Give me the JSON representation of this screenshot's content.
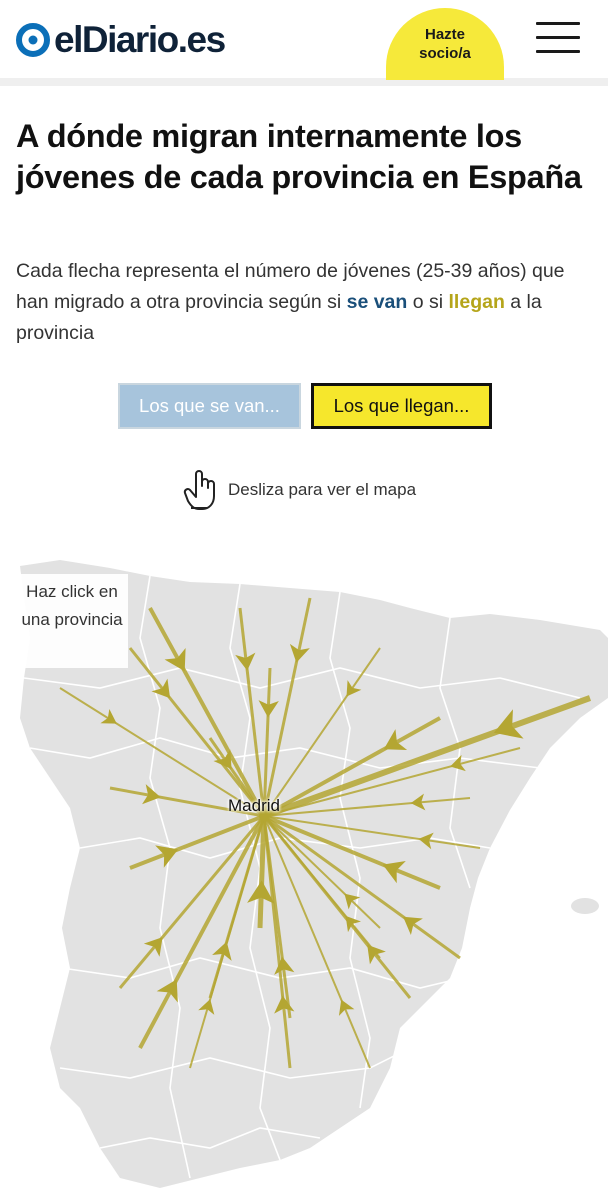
{
  "header": {
    "logo_text": "elDiario.es",
    "subscribe_line1": "Hazte",
    "subscribe_line2": "socio/a",
    "menu_icon": "hamburger-menu-icon"
  },
  "article": {
    "title": "A dónde migran internamente los jóvenes de cada provincia en España",
    "subtitle_part1": "Cada flecha representa el número de jóvenes (25-39 años) que han migrado a otra provincia según si ",
    "subtitle_hl1": "se van",
    "subtitle_part2": " o si ",
    "subtitle_hl2": "llegan",
    "subtitle_part3": " a la provincia"
  },
  "toggle": {
    "van_label": "Los que se van...",
    "llegan_label": "Los que llegan...",
    "selected": "llegan"
  },
  "swipe": {
    "text": "Desliza para ver el mapa",
    "icon": "hand-pointer-icon"
  },
  "map": {
    "hint": "Haz click en una provincia",
    "selected_province": "Madrid",
    "colors": {
      "land": "#e2e2e2",
      "border": "#ffffff",
      "arrow": "#b4a632",
      "van_accent": "#1a4f7a",
      "llegan_accent": "#f6e72c"
    }
  }
}
